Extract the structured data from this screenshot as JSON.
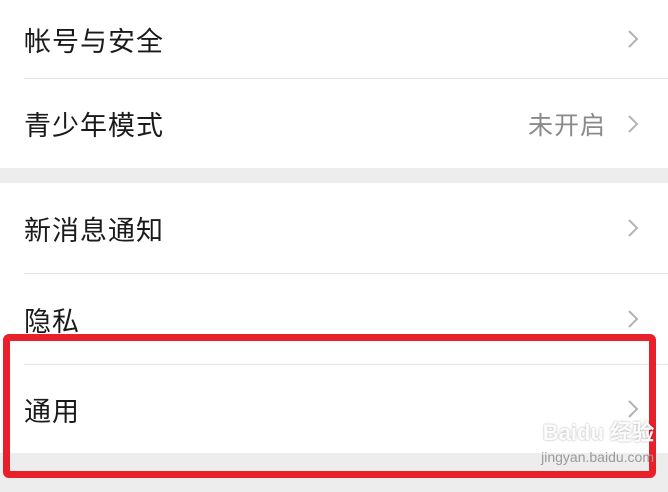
{
  "settings": {
    "group1": [
      {
        "label": "帐号与安全",
        "value": ""
      },
      {
        "label": "青少年模式",
        "value": "未开启"
      }
    ],
    "group2": [
      {
        "label": "新消息通知",
        "value": ""
      },
      {
        "label": "隐私",
        "value": ""
      },
      {
        "label": "通用",
        "value": ""
      }
    ]
  },
  "watermark": {
    "logo": "Baidu 经验",
    "url": "jingyan.baidu.com"
  },
  "colors": {
    "highlight": "#e8202a",
    "background": "#ededed",
    "row_background": "#ffffff",
    "secondary_text": "#8a8a8a"
  },
  "icons": {
    "chevron": "chevron-right-icon"
  }
}
